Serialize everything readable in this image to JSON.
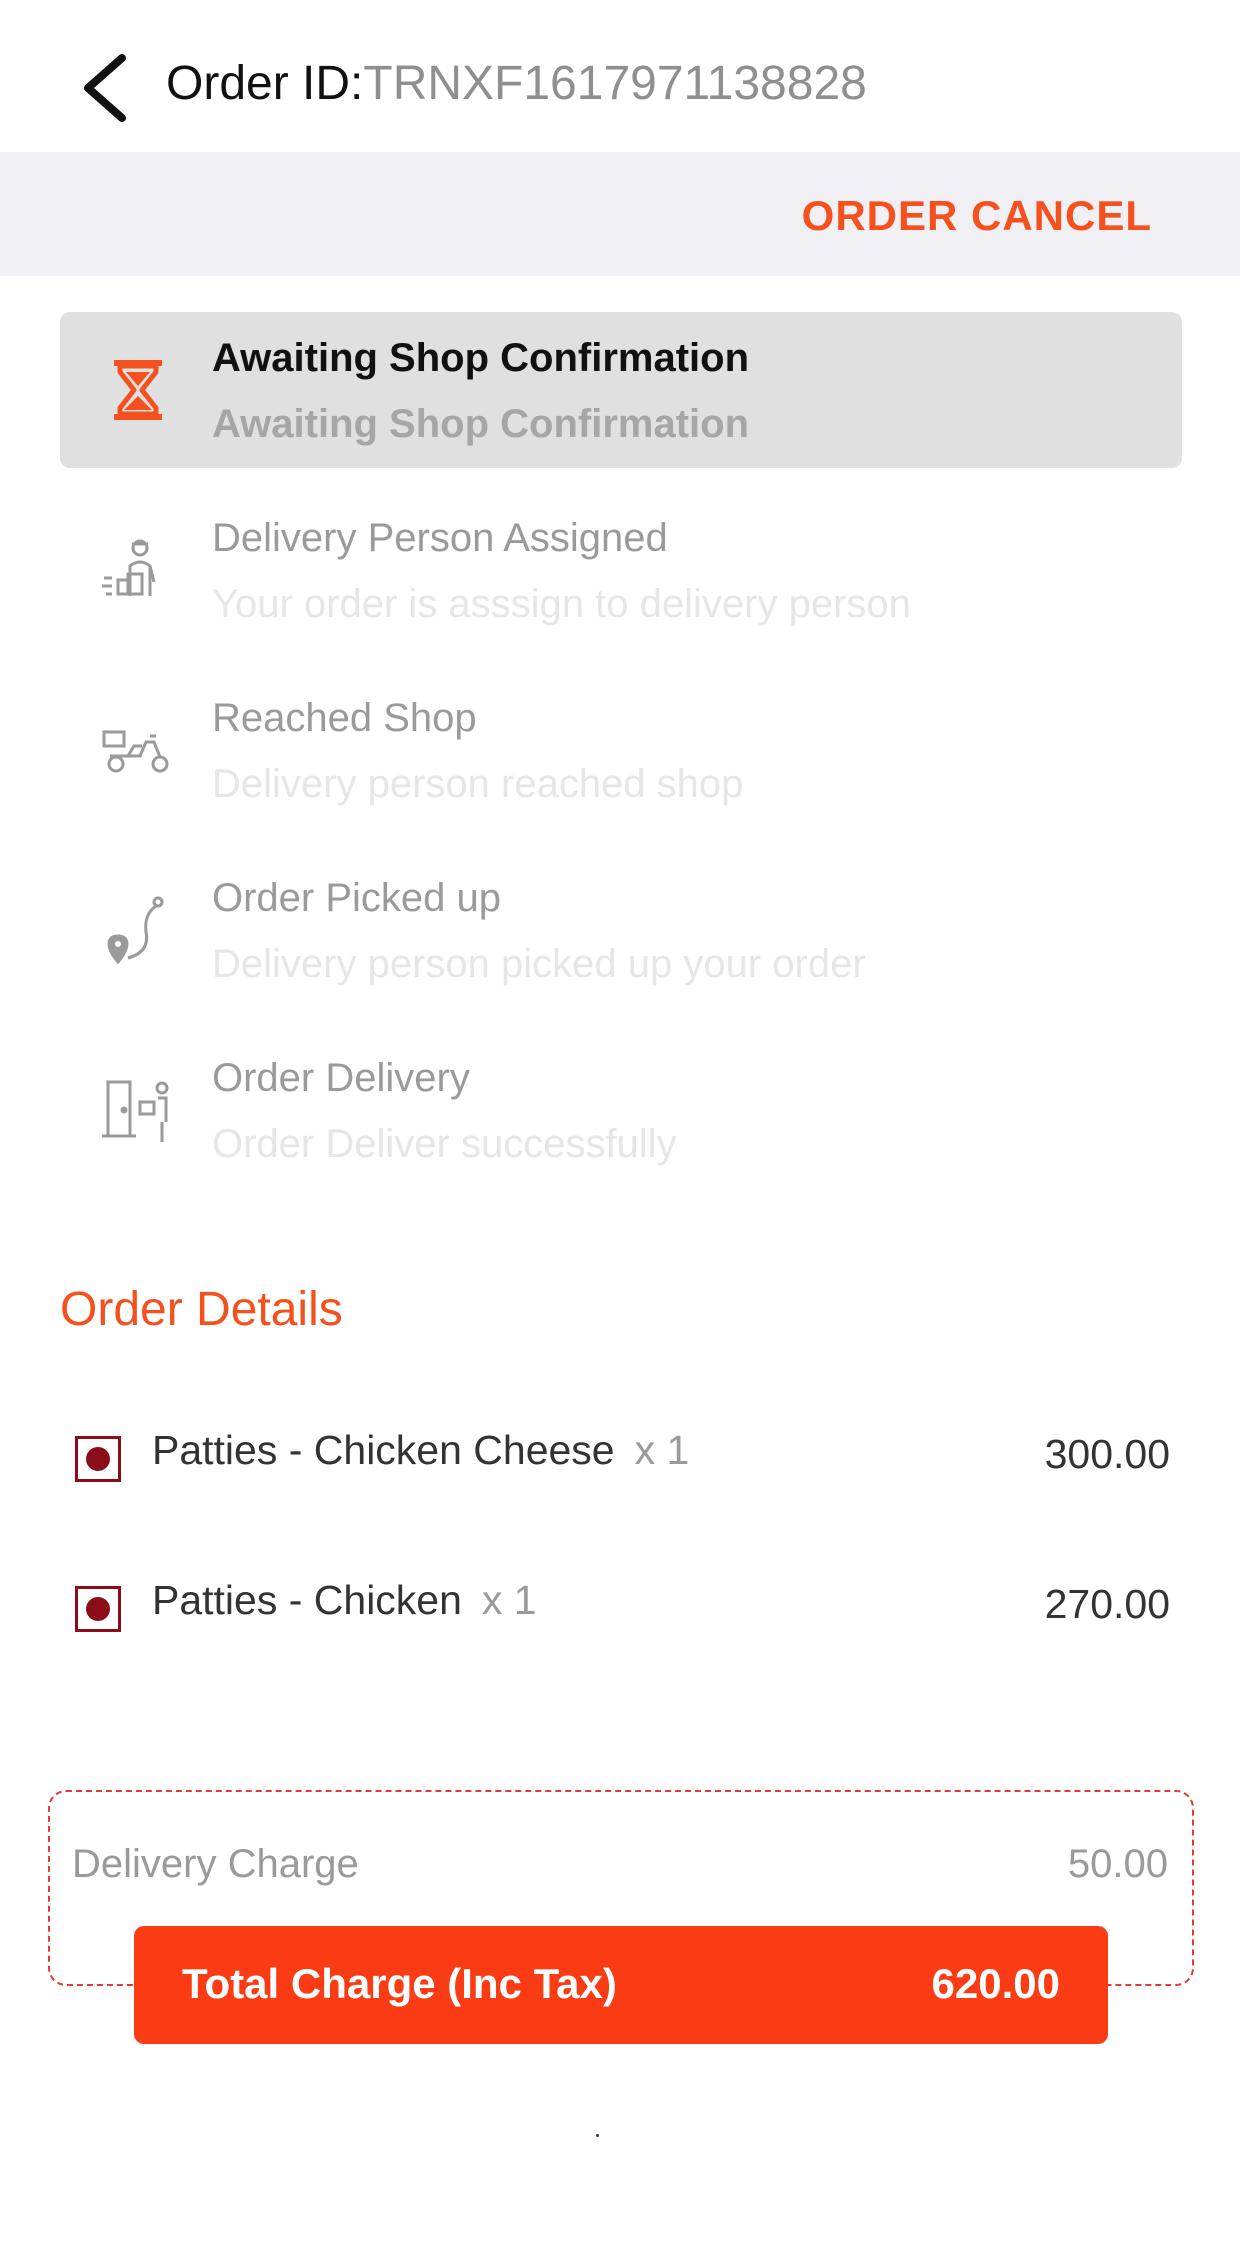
{
  "header": {
    "order_id_label": "Order ID:",
    "order_id_value": "TRNXF1617971138828"
  },
  "actions": {
    "cancel_label": "ORDER CANCEL"
  },
  "steps": [
    {
      "title": "Awaiting Shop Confirmation",
      "subtitle": "Awaiting Shop Confirmation",
      "icon": "hourglass-icon",
      "active": true
    },
    {
      "title": "Delivery Person Assigned",
      "subtitle": "Your order is asssign to delivery person",
      "icon": "delivery-person-icon",
      "active": false
    },
    {
      "title": "Reached Shop",
      "subtitle": "Delivery person reached shop",
      "icon": "scooter-icon",
      "active": false
    },
    {
      "title": "Order Picked up",
      "subtitle": "Delivery person picked up your order",
      "icon": "route-pin-icon",
      "active": false
    },
    {
      "title": "Order Delivery",
      "subtitle": "Order Deliver successfully",
      "icon": "door-delivery-icon",
      "active": false
    }
  ],
  "details": {
    "title": "Order Details",
    "items": [
      {
        "name": "Patties - Chicken Cheese",
        "qty": "x 1",
        "price": "300.00"
      },
      {
        "name": "Patties - Chicken",
        "qty": "x 1",
        "price": "270.00"
      }
    ]
  },
  "charges": {
    "delivery_label": "Delivery Charge",
    "delivery_value": "50.00",
    "total_label": "Total Charge (Inc Tax)",
    "total_value": "620.00"
  },
  "colors": {
    "accent": "#f4511e",
    "total_button": "#fb3b14",
    "nonveg_mark": "#8b0d1a",
    "active_step_bg": "#e0e0e0"
  }
}
